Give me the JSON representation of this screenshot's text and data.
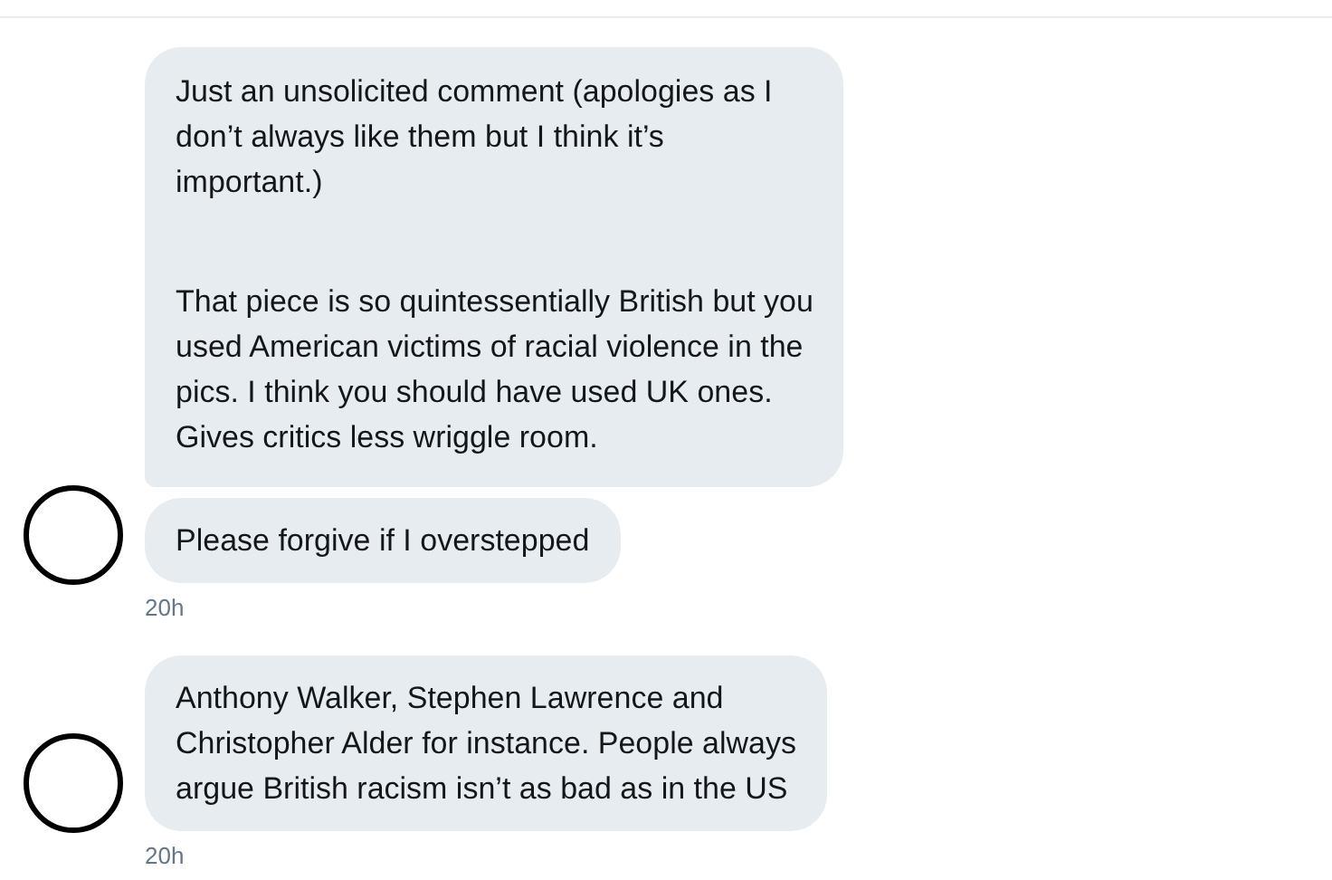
{
  "groups": [
    {
      "bubbles": [
        {
          "paragraphs": [
            [
              "Just an unsolicited comment (apologies as I",
              "don’t always like them but I think it’s",
              "important.)"
            ],
            [
              "That piece is so quintessentially British but you",
              "used American victims of racial violence in the",
              "pics. I think you should have used UK ones.",
              "Gives critics less wriggle room."
            ]
          ]
        },
        {
          "paragraphs": [
            [
              "Please forgive if I overstepped"
            ]
          ]
        }
      ],
      "time": "20h"
    },
    {
      "bubbles": [
        {
          "paragraphs": [
            [
              "Anthony Walker, Stephen Lawrence and",
              "Christopher Alder for instance. People always",
              "argue British racism isn’t as bad as in the US"
            ]
          ]
        }
      ],
      "time": "20h"
    }
  ]
}
